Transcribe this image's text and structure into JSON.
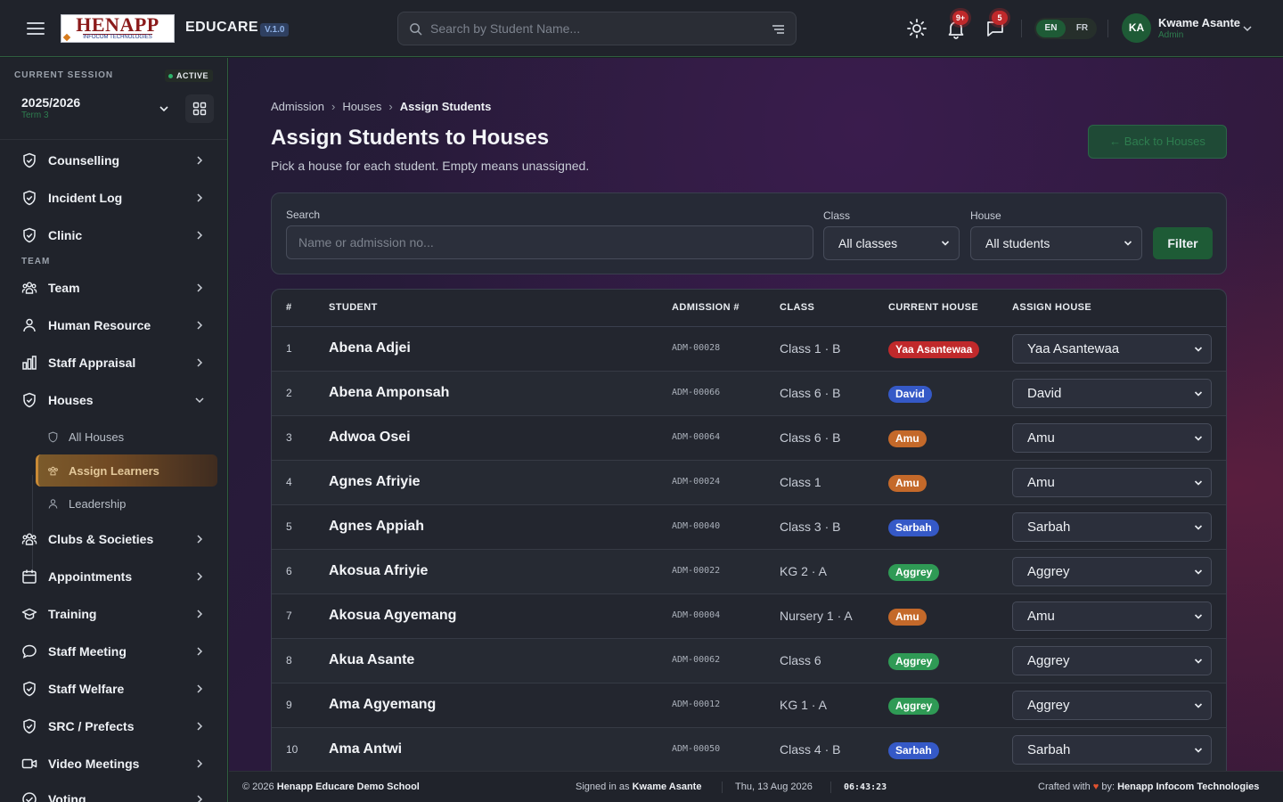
{
  "header": {
    "logo_text": "HENAPP",
    "logo_subtext": "INFOCOM TECHNOLOGIES",
    "brand": "EDUCARE",
    "version": "V.1.0",
    "search_placeholder": "Search by Student Name...",
    "notifications_badge": "9+",
    "messages_badge": "5",
    "languages": [
      "EN",
      "FR"
    ],
    "active_language": "EN",
    "user_initials": "KA",
    "user_name": "Kwame Asante",
    "user_role": "Admin"
  },
  "session": {
    "label": "CURRENT SESSION",
    "status": "ACTIVE",
    "year": "2025/2026",
    "term": "Term 3"
  },
  "sidebar": {
    "items_top": [
      {
        "label": "Counselling",
        "icon": "shield-icon"
      },
      {
        "label": "Incident Log",
        "icon": "shield-icon"
      },
      {
        "label": "Clinic",
        "icon": "shield-icon"
      }
    ],
    "section_team": "TEAM",
    "items_team": [
      {
        "label": "Team",
        "icon": "users-icon"
      },
      {
        "label": "Human Resource",
        "icon": "user-icon"
      },
      {
        "label": "Staff Appraisal",
        "icon": "bar-chart-icon"
      },
      {
        "label": "Houses",
        "icon": "shield-icon"
      }
    ],
    "houses_sub": [
      {
        "label": "All Houses",
        "icon": "shield-icon"
      },
      {
        "label": "Assign Learners",
        "icon": "users-icon"
      },
      {
        "label": "Leadership",
        "icon": "user-icon"
      }
    ],
    "items_bottom": [
      {
        "label": "Clubs & Societies",
        "icon": "users-icon"
      },
      {
        "label": "Appointments",
        "icon": "calendar-icon"
      },
      {
        "label": "Training",
        "icon": "graduation-cap-icon"
      },
      {
        "label": "Staff Meeting",
        "icon": "chat-bubble-icon"
      },
      {
        "label": "Staff Welfare",
        "icon": "shield-icon"
      },
      {
        "label": "SRC / Prefects",
        "icon": "shield-icon"
      },
      {
        "label": "Video Meetings",
        "icon": "video-icon"
      },
      {
        "label": "Voting",
        "icon": "check-icon"
      }
    ]
  },
  "page": {
    "breadcrumb": [
      "Admission",
      "Houses",
      "Assign Students"
    ],
    "title": "Assign Students to Houses",
    "subtitle": "Pick a house for each student. Empty means unassigned.",
    "back_button": "← Back to Houses"
  },
  "filters": {
    "search_label": "Search",
    "search_placeholder": "Name or admission no...",
    "class_label": "Class",
    "class_value": "All classes",
    "house_label": "House",
    "house_value": "All students",
    "filter_button": "Filter"
  },
  "table": {
    "columns": [
      "#",
      "STUDENT",
      "ADMISSION #",
      "CLASS",
      "CURRENT HOUSE",
      "ASSIGN HOUSE"
    ],
    "rows": [
      {
        "num": "1",
        "name": "Abena Adjei",
        "admission": "ADM-00028",
        "class": "Class 1 · B",
        "house": "Yaa Asantewaa",
        "assign": "Yaa Asantewaa"
      },
      {
        "num": "2",
        "name": "Abena Amponsah",
        "admission": "ADM-00066",
        "class": "Class 6 · B",
        "house": "David",
        "assign": "David"
      },
      {
        "num": "3",
        "name": "Adwoa Osei",
        "admission": "ADM-00064",
        "class": "Class 6 · B",
        "house": "Amu",
        "assign": "Amu"
      },
      {
        "num": "4",
        "name": "Agnes Afriyie",
        "admission": "ADM-00024",
        "class": "Class 1",
        "house": "Amu",
        "assign": "Amu"
      },
      {
        "num": "5",
        "name": "Agnes Appiah",
        "admission": "ADM-00040",
        "class": "Class 3 · B",
        "house": "Sarbah",
        "assign": "Sarbah"
      },
      {
        "num": "6",
        "name": "Akosua Afriyie",
        "admission": "ADM-00022",
        "class": "KG 2 · A",
        "house": "Aggrey",
        "assign": "Aggrey"
      },
      {
        "num": "7",
        "name": "Akosua Agyemang",
        "admission": "ADM-00004",
        "class": "Nursery 1 · A",
        "house": "Amu",
        "assign": "Amu"
      },
      {
        "num": "8",
        "name": "Akua Asante",
        "admission": "ADM-00062",
        "class": "Class 6",
        "house": "Aggrey",
        "assign": "Aggrey"
      },
      {
        "num": "9",
        "name": "Ama Agyemang",
        "admission": "ADM-00012",
        "class": "KG 1 · A",
        "house": "Aggrey",
        "assign": "Aggrey"
      },
      {
        "num": "10",
        "name": "Ama Antwi",
        "admission": "ADM-00050",
        "class": "Class 4 · B",
        "house": "Sarbah",
        "assign": "Sarbah"
      }
    ]
  },
  "house_colors": {
    "Yaa Asantewaa": "#c0292b",
    "David": "#3559c7",
    "Amu": "#c4692a",
    "Sarbah": "#3559c7",
    "Aggrey": "#2f9a55"
  },
  "footer": {
    "copyright": "© 2026",
    "school": "Henapp Educare Demo School",
    "signed_in_prefix": "Signed in as",
    "signed_in_user": "Kwame Asante",
    "date": "Thu, 13 Aug 2026",
    "time": "06:43:23",
    "crafted_prefix": "Crafted with",
    "crafted_by": "by:",
    "company": "Henapp Infocom Technologies"
  },
  "colors": {
    "accent_green": "#1e5b36",
    "active_item": "#7b5a2b"
  }
}
